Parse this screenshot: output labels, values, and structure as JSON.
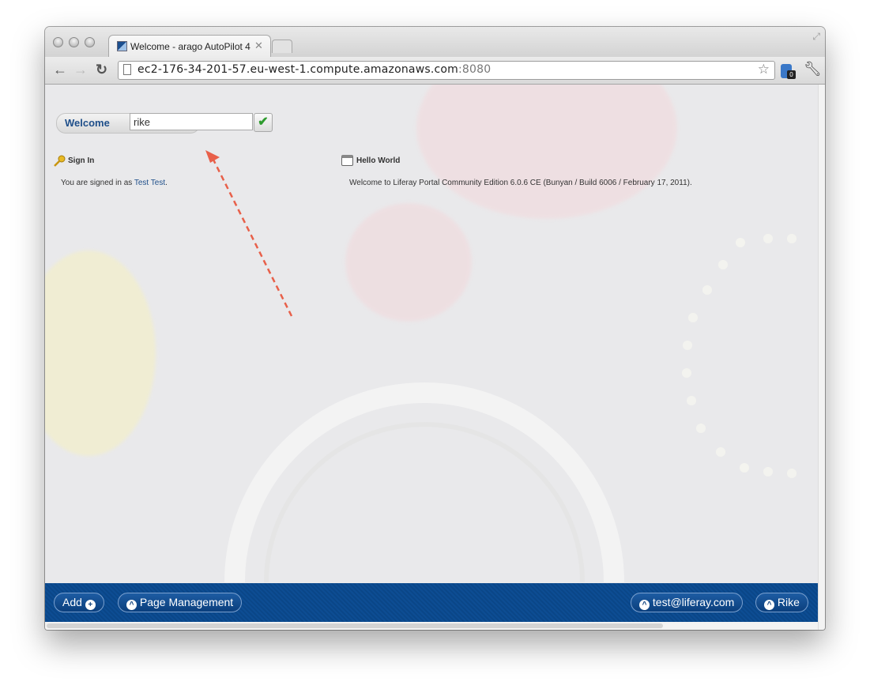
{
  "browser": {
    "tab_title": "Welcome - arago AutoPilot 4",
    "tab_close": "✕",
    "url_host": "ec2-176-34-201-57.eu-west-1.compute.amazonaws.com",
    "url_port": ":8080",
    "extension_badge": "0",
    "icons": [
      "back-icon",
      "forward-icon",
      "reload-icon",
      "page-icon",
      "bookmark-star-icon",
      "extension-icon",
      "wrench-icon"
    ]
  },
  "page": {
    "welcome_label": "Welcome",
    "page_name_value": "rike",
    "sign_in": {
      "title": "Sign In",
      "text_prefix": "You are signed in as ",
      "user_link": "Test Test",
      "text_suffix": "."
    },
    "hello_world": {
      "title": "Hello World",
      "text": "Welcome to Liferay Portal Community Edition 6.0.6 CE (Bunyan / Build 6006 / February 17, 2011)."
    },
    "annotation_color": "#e8604a"
  },
  "dockbar": {
    "add_label": "Add",
    "page_management_label": "Page Management",
    "user_email": "test@liferay.com",
    "user_name": "Rike",
    "accent": "#0d4d93"
  }
}
